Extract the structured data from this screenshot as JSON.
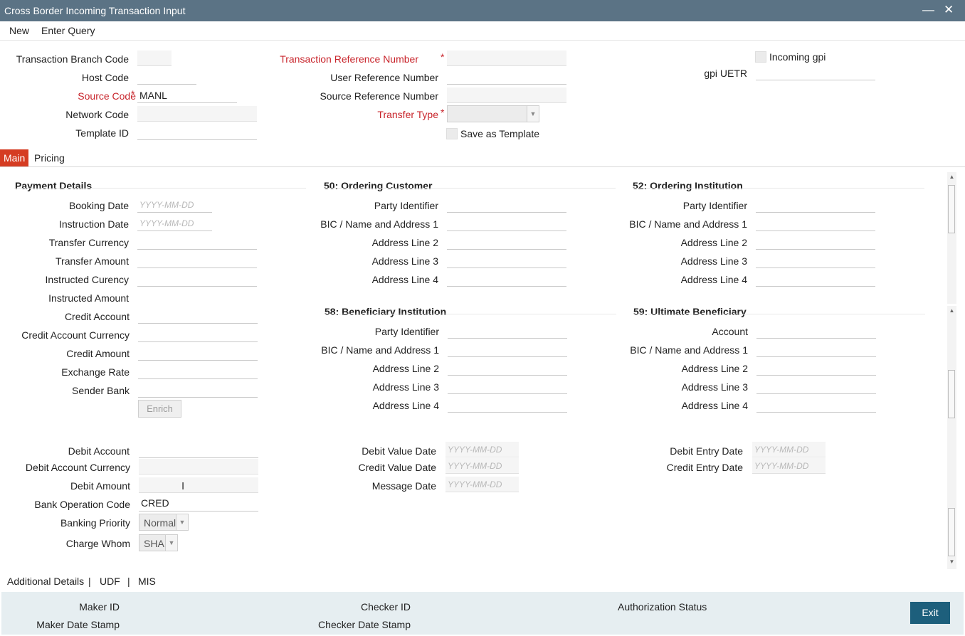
{
  "window": {
    "title": "Cross Border Incoming Transaction Input",
    "minimize_icon": "minimize-icon",
    "close_icon": "close-icon"
  },
  "menu": {
    "new": "New",
    "enter_query": "Enter Query"
  },
  "header": {
    "branch_code": "Transaction Branch Code",
    "host_code": "Host Code",
    "source_code": "Source Code",
    "source_code_value": "MANL",
    "network_code": "Network Code",
    "template_id": "Template ID",
    "txn_ref": "Transaction Reference Number",
    "user_ref": "User Reference Number",
    "source_ref": "Source Reference Number",
    "transfer_type": "Transfer Type",
    "save_template": "Save as Template",
    "incoming_gpi": "Incoming gpi",
    "gpi_uetr": "gpi UETR",
    "required_mark": "*"
  },
  "tabs": {
    "main": "Main",
    "pricing": "Pricing"
  },
  "payment": {
    "title": "Payment Details",
    "booking_date": "Booking Date",
    "instruction_date": "Instruction Date",
    "transfer_currency": "Transfer Currency",
    "transfer_amount": "Transfer Amount",
    "instructed_currency": "Instructed Curency",
    "instructed_amount": "Instructed Amount",
    "credit_account": "Credit Account",
    "credit_account_currency": "Credit Account Currency",
    "credit_amount": "Credit Amount",
    "exchange_rate": "Exchange Rate",
    "sender_bank": "Sender Bank",
    "enrich": "Enrich",
    "date_placeholder": "YYYY-MM-DD"
  },
  "ordering_customer": {
    "title": "50: Ordering Customer",
    "party_identifier": "Party Identifier",
    "bic": "BIC / Name and Address 1",
    "addr2": "Address Line 2",
    "addr3": "Address Line 3",
    "addr4": "Address Line 4"
  },
  "ordering_institution": {
    "title": "52: Ordering Institution",
    "party_identifier": "Party Identifier",
    "bic": "BIC / Name and Address 1",
    "addr2": "Address Line 2",
    "addr3": "Address Line 3",
    "addr4": "Address Line 4"
  },
  "beneficiary_institution": {
    "title": "58: Beneficiary Institution",
    "party_identifier": "Party Identifier",
    "bic": "BIC / Name and Address 1",
    "addr2": "Address Line 2",
    "addr3": "Address Line 3",
    "addr4": "Address Line 4"
  },
  "ultimate_beneficiary": {
    "title": "59: Ultimate Beneficiary",
    "account": "Account",
    "bic": "BIC / Name and Address 1",
    "addr2": "Address Line 2",
    "addr3": "Address Line 3",
    "addr4": "Address Line 4"
  },
  "debit": {
    "debit_account": "Debit Account",
    "debit_account_currency": "Debit Account Currency",
    "debit_amount": "Debit Amount",
    "bank_operation_code": "Bank Operation Code",
    "bank_operation_code_value": "CRED",
    "banking_priority": "Banking Priority",
    "banking_priority_value": "Normal",
    "charge_whom": "Charge Whom",
    "charge_whom_value": "SHA",
    "debit_value_date": "Debit Value Date",
    "credit_value_date": "Credit Value Date",
    "message_date": "Message Date",
    "debit_entry_date": "Debit Entry Date",
    "credit_entry_date": "Credit Entry Date"
  },
  "footer_links": {
    "additional": "Additional Details",
    "udf": "UDF",
    "mis": "MIS",
    "separator": "|"
  },
  "audit": {
    "maker_id": "Maker ID",
    "maker_date": "Maker Date Stamp",
    "checker_id": "Checker ID",
    "checker_date": "Checker Date Stamp",
    "auth_status": "Authorization Status",
    "exit": "Exit"
  }
}
